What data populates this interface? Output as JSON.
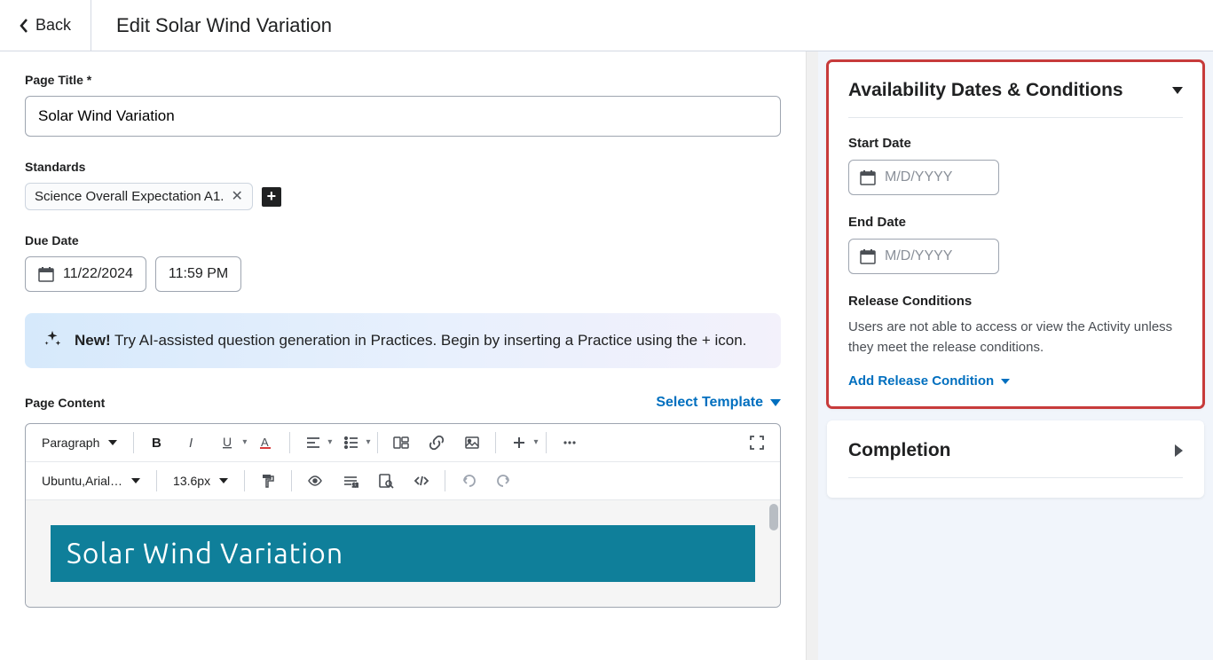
{
  "header": {
    "back_label": "Back",
    "title": "Edit Solar Wind Variation"
  },
  "form": {
    "page_title_label": "Page Title *",
    "page_title_value": "Solar Wind Variation",
    "standards_label": "Standards",
    "standard_chip": "Science Overall Expectation A1.",
    "due_date_label": "Due Date",
    "due_date_value": "11/22/2024",
    "due_time_value": "11:59 PM"
  },
  "banner": {
    "new_badge": "New!",
    "text": " Try AI-assisted question generation in Practices. Begin by inserting a Practice using the + icon."
  },
  "content": {
    "label": "Page Content",
    "select_template": "Select Template",
    "block_style": "Paragraph",
    "font_family": "Ubuntu,Arial…",
    "font_size": "13.6px",
    "doc_heading": "Solar  Wind  Variation"
  },
  "sidebar": {
    "availability": {
      "title": "Availability Dates & Conditions",
      "start_label": "Start Date",
      "end_label": "End Date",
      "date_placeholder": "M/D/YYYY",
      "release_title": "Release Conditions",
      "release_desc": "Users are not able to access or view the Activity unless they meet the release conditions.",
      "add_release": "Add Release Condition"
    },
    "completion": {
      "title": "Completion"
    }
  }
}
